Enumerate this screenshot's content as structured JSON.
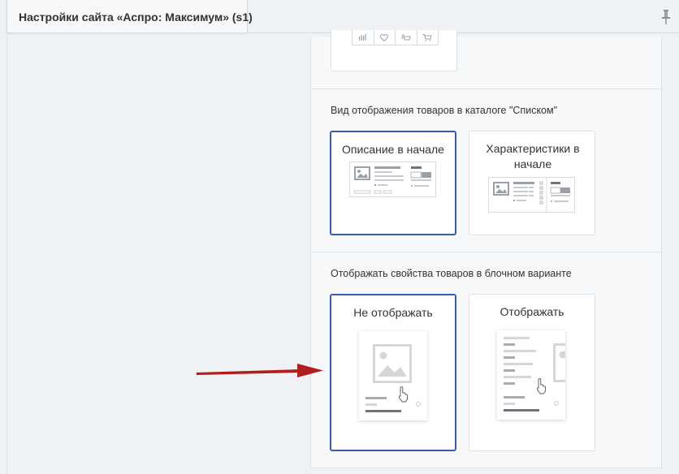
{
  "window": {
    "title": "Настройки сайта «Аспро: Максимум» (s1)"
  },
  "icons": {
    "pin": "pin-icon",
    "toolbar": [
      "compare-icon",
      "favorite-heart-icon",
      "quick-order-icon",
      "cart-icon"
    ]
  },
  "sections": [
    {
      "title": "Вид отображения товаров в каталоге \"Списком\"",
      "options": [
        {
          "label": "Описание в начале",
          "selected": true
        },
        {
          "label": "Характеристики в начале",
          "selected": false
        }
      ]
    },
    {
      "title": "Отображать свойства товаров в блочном варианте",
      "options": [
        {
          "label": "Не отображать",
          "selected": true
        },
        {
          "label": "Отображать",
          "selected": false
        }
      ]
    }
  ],
  "colors": {
    "selected_border": "#3a5ba6",
    "arrow": "#b01e1e"
  }
}
